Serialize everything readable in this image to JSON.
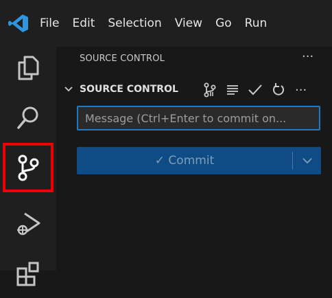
{
  "titlebar": {
    "menu": [
      "File",
      "Edit",
      "Selection",
      "View",
      "Go",
      "Run"
    ]
  },
  "activitybar": {
    "items": [
      "explorer",
      "search",
      "source-control",
      "run-and-debug",
      "extensions"
    ],
    "active": "source-control",
    "highlight_color": "#ee0000"
  },
  "sidebar": {
    "title": "SOURCE CONTROL",
    "more": "···",
    "section": {
      "title": "SOURCE CONTROL",
      "more": "···"
    },
    "message_placeholder": "Message (Ctrl+Enter to commit on...",
    "commit_label": "✓ Commit"
  },
  "colors": {
    "accent": "#1e79c6",
    "commit_button": "#0f4c85",
    "vscode_blue": "#2f95dc"
  }
}
